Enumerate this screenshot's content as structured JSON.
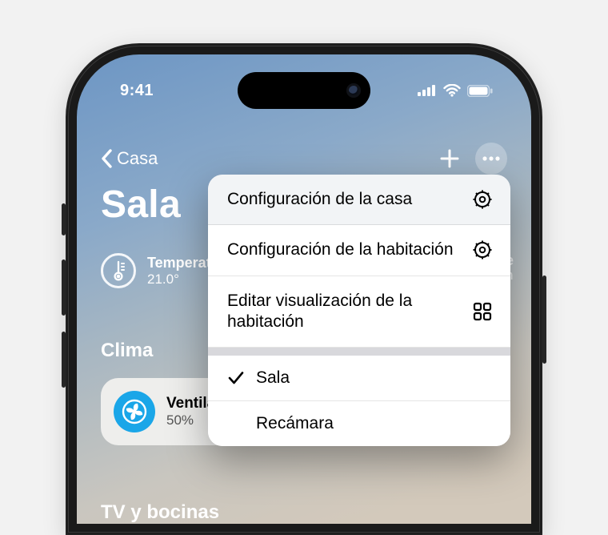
{
  "status": {
    "time": "9:41"
  },
  "nav": {
    "back_label": "Casa"
  },
  "page": {
    "title": "Sala"
  },
  "sensor": {
    "label": "Temperatu",
    "value": "21.0°"
  },
  "sections": {
    "climate": "Clima",
    "tv": "TV y bocinas"
  },
  "tile": {
    "name": "Ventilad",
    "sub": "50%"
  },
  "ghost": {
    "a": "e",
    "b": "n"
  },
  "menu": {
    "items": [
      {
        "label": "Configuración de la casa"
      },
      {
        "label": "Configuración de la habitación"
      },
      {
        "label": "Editar visualización de la habitación"
      }
    ],
    "rooms": [
      {
        "label": "Sala",
        "checked": true
      },
      {
        "label": "Recámara",
        "checked": false
      }
    ]
  }
}
